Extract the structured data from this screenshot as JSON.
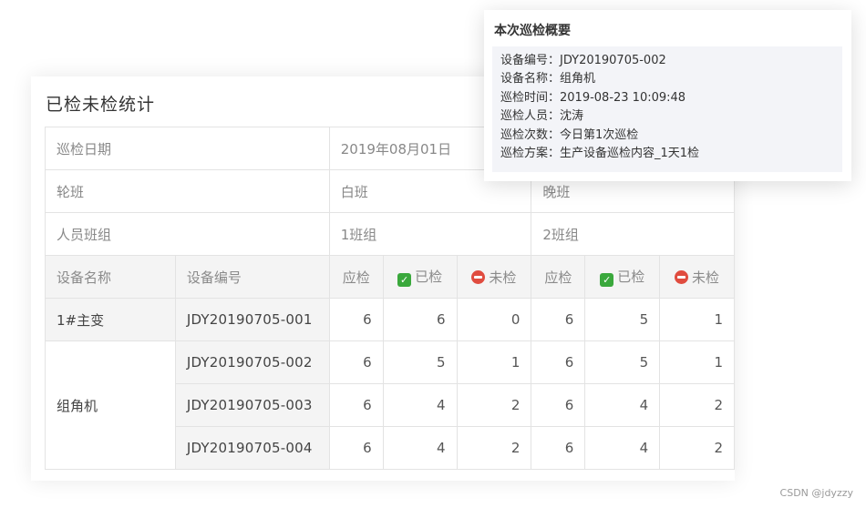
{
  "card": {
    "title": "已检未检统计",
    "rows": {
      "date_label": "巡检日期",
      "date_value": "2019年08月01日",
      "shift_label": "轮班",
      "shift_day": "白班",
      "shift_night": "晚班",
      "group_label": "人员班组",
      "group_day": "1班组",
      "group_night": "2班组"
    },
    "columns": {
      "device_name": "设备名称",
      "device_code": "设备编号",
      "due": "应检",
      "done": "已检",
      "pending": "未检"
    },
    "devices": [
      {
        "name": "1#主变",
        "code": "JDY20190705-001",
        "day": [
          "6",
          "6",
          "0"
        ],
        "night": [
          "6",
          "5",
          "1"
        ]
      },
      {
        "name": "组角机",
        "code": "JDY20190705-002",
        "day": [
          "6",
          "5",
          "1"
        ],
        "night": [
          "6",
          "5",
          "1"
        ]
      },
      {
        "code": "JDY20190705-003",
        "day": [
          "6",
          "4",
          "2"
        ],
        "night": [
          "6",
          "4",
          "2"
        ]
      },
      {
        "code": "JDY20190705-004",
        "day": [
          "6",
          "4",
          "2"
        ],
        "night": [
          "6",
          "4",
          "2"
        ]
      }
    ]
  },
  "tooltip": {
    "title": "本次巡检概要",
    "lines": [
      "设备编号：JDY20190705-002",
      "设备名称：组角机",
      "巡检时间：2019-08-23 10:09:48",
      "巡检人员：沈涛",
      "巡检次数：今日第1次巡检",
      "巡检方案：生产设备巡检内容_1天1检"
    ]
  },
  "icons": {
    "done": "green-check-icon",
    "pending": "red-minus-icon"
  },
  "colors": {
    "done": "#3aa83c",
    "pending": "#e04c3f",
    "header_bg": "#f4f4f4"
  },
  "watermark": "CSDN @jdyzzy"
}
